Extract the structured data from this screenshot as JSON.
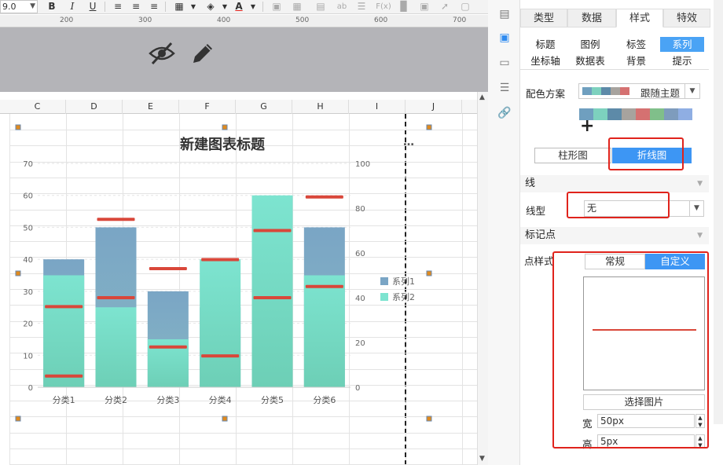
{
  "toolbar": {
    "font_size": "9.0",
    "bold": "B",
    "italic": "I",
    "underline": "U",
    "text_ab": "ab",
    "fx": "F(x)"
  },
  "ruler": {
    "marks": [
      "200",
      "300",
      "400",
      "500",
      "600",
      "700"
    ]
  },
  "gray_area": {
    "hide_icon": "eye-slash-icon",
    "edit_icon": "pencil-icon"
  },
  "sheet": {
    "columns": [
      "C",
      "D",
      "E",
      "F",
      "G",
      "H",
      "I",
      "J"
    ]
  },
  "chart_data": {
    "type": "bar",
    "title": "新建图表标题",
    "categories": [
      "分类1",
      "分类2",
      "分类3",
      "分类4",
      "分类5",
      "分类6"
    ],
    "series": [
      {
        "name": "系列1",
        "values": [
          40,
          50,
          30,
          25,
          35,
          50
        ],
        "color": "#7aa5c5"
      },
      {
        "name": "系列2",
        "values": [
          35,
          25,
          15,
          40,
          60,
          35
        ],
        "color": "#7de4d0"
      }
    ],
    "left_axis": {
      "ylim": [
        0,
        70
      ],
      "ticks": [
        "0",
        "10",
        "20",
        "30",
        "40",
        "50",
        "60",
        "70"
      ]
    },
    "right_axis": {
      "ylim": [
        0,
        100
      ],
      "ticks": [
        "0",
        "20",
        "40",
        "60",
        "80",
        "100"
      ]
    },
    "markers": [
      {
        "category": "分类1",
        "values": [
          5,
          36
        ]
      },
      {
        "category": "分类2",
        "values": [
          40,
          75
        ]
      },
      {
        "category": "分类3",
        "values": [
          18,
          53
        ]
      },
      {
        "category": "分类4",
        "values": [
          14,
          57
        ]
      },
      {
        "category": "分类5",
        "values": [
          40,
          70
        ]
      },
      {
        "category": "分类6",
        "values": [
          45,
          85
        ]
      }
    ],
    "marker_color": "#d9473a",
    "legend_position": "right",
    "grid": true
  },
  "panel": {
    "tabs": [
      "类型",
      "数据",
      "样式",
      "特效"
    ],
    "active_tab": "样式",
    "subtabs": [
      "标题",
      "图例",
      "标签",
      "系列",
      "坐标轴",
      "数据表",
      "背景",
      "提示"
    ],
    "active_subtab": "系列",
    "color_scheme_label": "配色方案",
    "color_scheme_value": "跟随主题",
    "palette": [
      "#6f9fbf",
      "#7dd1be",
      "#5d8aa8",
      "#a7a39e",
      "#d57171",
      "#80bf8a",
      "#7e9cbd",
      "#8faee3"
    ],
    "add_label": "+",
    "chart_type_buttons": [
      "柱形图",
      "折线图"
    ],
    "active_chart_type": "折线图",
    "section_line": "线",
    "line_type_label": "线型",
    "line_type_value": "无",
    "section_marker": "标记点",
    "point_style_label": "点样式",
    "point_style_tabs": [
      "常规",
      "自定义"
    ],
    "active_point_style": "自定义",
    "select_image_button": "选择图片",
    "width_label": "宽",
    "width_value": "50px",
    "height_label": "高",
    "height_value": "5px"
  }
}
